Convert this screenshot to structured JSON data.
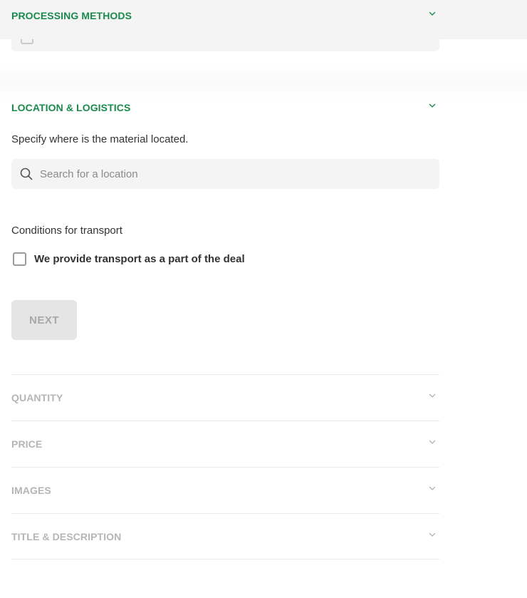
{
  "sections": {
    "processing_methods": {
      "title": "PROCESSING METHODS"
    },
    "location": {
      "title": "LOCATION & LOGISTICS",
      "description": "Specify where is the material located.",
      "search_placeholder": "Search for a location",
      "transport_label": "Conditions for transport",
      "transport_option": "We provide transport as a part of the deal",
      "next_label": "NEXT"
    },
    "collapsed": [
      {
        "title": "QUANTITY"
      },
      {
        "title": "PRICE"
      },
      {
        "title": "IMAGES"
      },
      {
        "title": "TITLE & DESCRIPTION"
      }
    ]
  },
  "colors": {
    "accent": "#1a8a4c",
    "muted": "#b5b5b5",
    "field_bg": "#f4f4f4"
  },
  "icons": {
    "chevron": "chevron-down-icon",
    "search": "search-icon"
  }
}
